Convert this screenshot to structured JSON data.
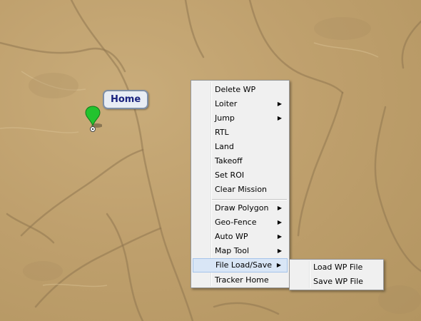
{
  "map": {
    "home_label": "Home"
  },
  "context_menu": {
    "items": [
      {
        "label": "Delete WP",
        "submenu": false
      },
      {
        "label": "Loiter",
        "submenu": true
      },
      {
        "label": "Jump",
        "submenu": true
      },
      {
        "label": "RTL",
        "submenu": false
      },
      {
        "label": "Land",
        "submenu": false
      },
      {
        "label": "Takeoff",
        "submenu": false
      },
      {
        "label": "Set ROI",
        "submenu": false
      },
      {
        "label": "Clear Mission",
        "submenu": false
      },
      {
        "label": "Draw Polygon",
        "submenu": true
      },
      {
        "label": "Geo-Fence",
        "submenu": true
      },
      {
        "label": "Auto WP",
        "submenu": true
      },
      {
        "label": "Map Tool",
        "submenu": true
      },
      {
        "label": "File Load/Save",
        "submenu": true,
        "highlighted": true
      },
      {
        "label": "Tracker Home",
        "submenu": false
      }
    ],
    "submenu_arrow": "▶"
  },
  "submenu": {
    "items": [
      {
        "label": "Load WP File"
      },
      {
        "label": "Save WP File"
      }
    ]
  },
  "colors": {
    "marker": "#22c32e",
    "highlight": "#d9e6f6"
  }
}
